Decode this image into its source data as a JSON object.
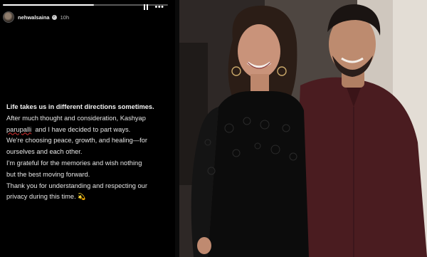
{
  "story": {
    "progress": 0.55,
    "username": "nehwalsaina",
    "verified_badge": "verified-icon",
    "time_ago": "10h",
    "controls": {
      "pause": "pause-icon",
      "more": "more-icon"
    },
    "lines": [
      "Life takes us in different directions sometimes.",
      "After much thought and consideration, Kashyap",
      "and I have decided to part ways.",
      "We're choosing peace, growth, and healing—for",
      "ourselves and each other.",
      "I'm grateful for the memories and wish nothing",
      "but the best moving forward.",
      "Thank you for understanding and respecting our",
      "privacy during this time."
    ],
    "mention": "parupalli",
    "emoji": "💫"
  },
  "photo": {
    "colors": {
      "background": "#5b524c",
      "dress": "#0c0c0c",
      "shirt": "#4a1c20",
      "skin": "#c58f73"
    }
  }
}
